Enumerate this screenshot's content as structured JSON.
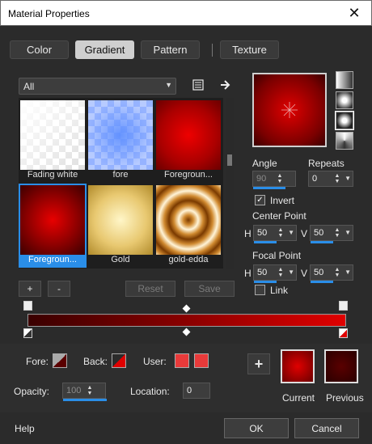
{
  "window": {
    "title": "Material Properties"
  },
  "tabs": [
    {
      "label": "Color"
    },
    {
      "label": "Gradient"
    },
    {
      "label": "Pattern"
    },
    {
      "label": "Texture"
    }
  ],
  "gallery": {
    "category": "All",
    "items": [
      {
        "label": "Fading white"
      },
      {
        "label": "fore"
      },
      {
        "label": "Foregroun..."
      },
      {
        "label": "Foregroun..."
      },
      {
        "label": "Gold"
      },
      {
        "label": "gold-edda"
      }
    ],
    "selected_index": 3,
    "add_label": "+",
    "remove_label": "-",
    "reset_label": "Reset",
    "save_label": "Save"
  },
  "gradient": {
    "angle_label": "Angle",
    "angle_value": "90",
    "repeats_label": "Repeats",
    "repeats_value": "0",
    "invert_label": "Invert",
    "invert_checked": true,
    "center_label": "Center Point",
    "center_h": "50",
    "center_v": "50",
    "focal_label": "Focal Point",
    "focal_h": "50",
    "focal_v": "50",
    "h_label": "H",
    "v_label": "V",
    "link_label": "Link",
    "link_checked": false
  },
  "stops": {
    "fore_label": "Fore:",
    "back_label": "Back:",
    "user_label": "User:",
    "opacity_label": "Opacity:",
    "opacity_value": "100",
    "location_label": "Location:",
    "location_value": "0"
  },
  "swatches": {
    "add_label": "+",
    "current_label": "Current",
    "previous_label": "Previous"
  },
  "footer": {
    "help_label": "Help",
    "ok_label": "OK",
    "cancel_label": "Cancel"
  },
  "colors": {
    "accent": "#2a8ee8",
    "gradient_dark": "#3a0000",
    "gradient_light": "#e00000"
  }
}
